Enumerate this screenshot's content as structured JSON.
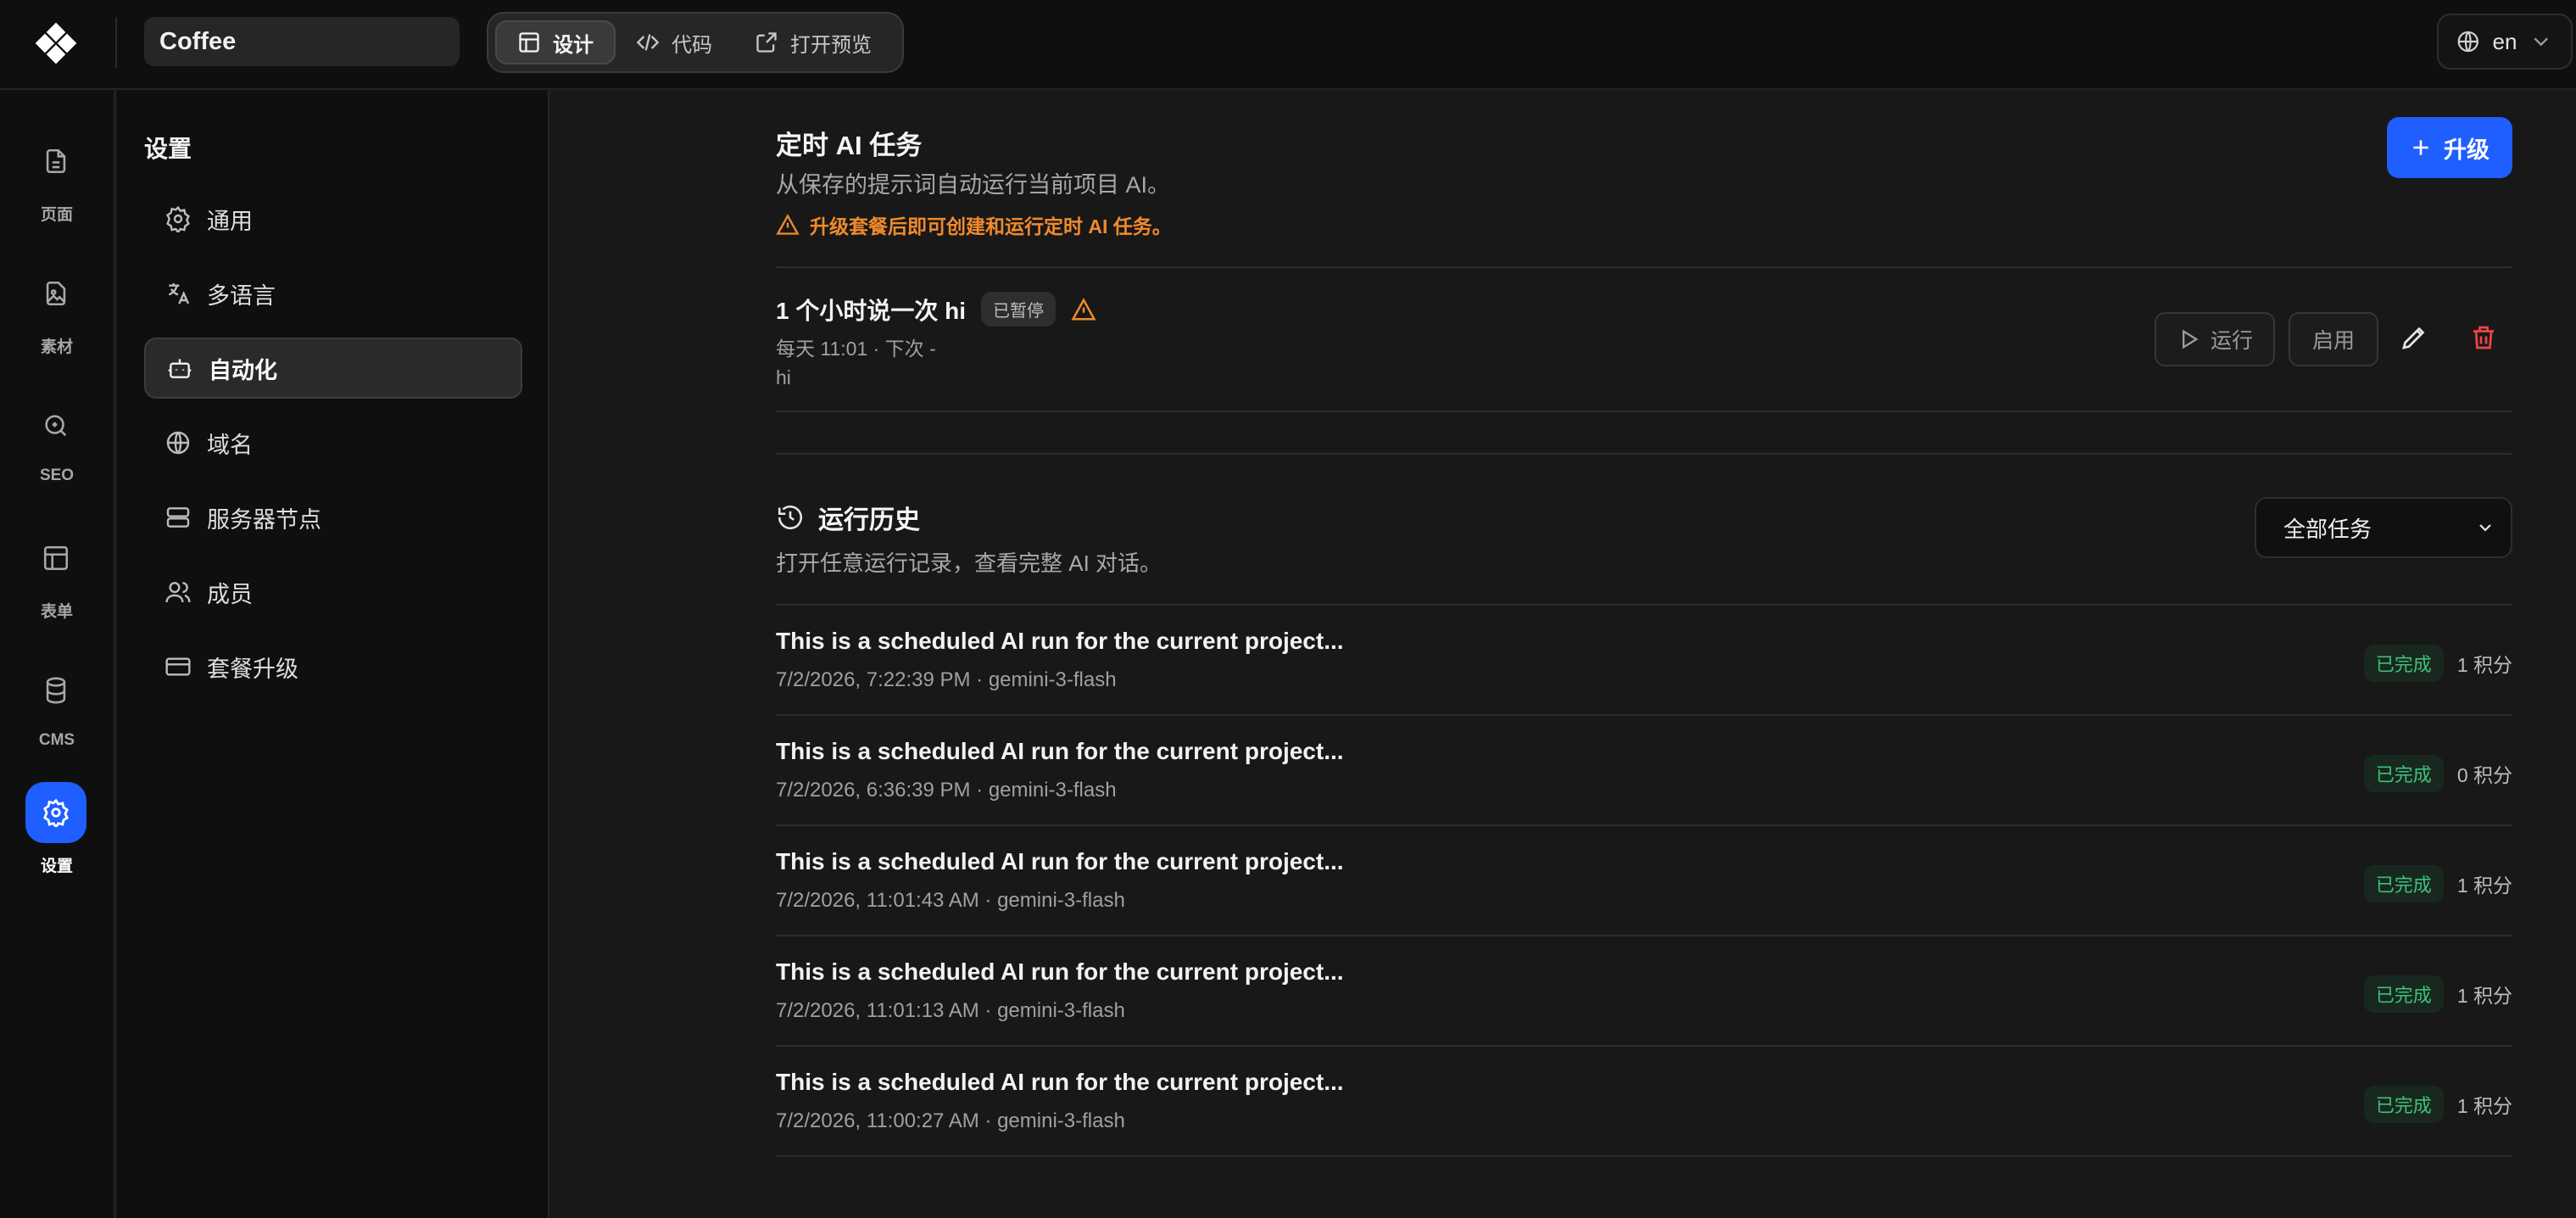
{
  "app": {
    "project_name": "Coffee"
  },
  "mode_tabs": [
    {
      "label": "设计",
      "icon": "layout-icon"
    },
    {
      "label": "代码",
      "icon": "code-icon"
    },
    {
      "label": "打开预览",
      "icon": "external-link-icon"
    }
  ],
  "language": {
    "label": "en",
    "icon": "globe-icon"
  },
  "rail": [
    {
      "label": "页面",
      "icon": "page-icon"
    },
    {
      "label": "素材",
      "icon": "media-icon"
    },
    {
      "label": "SEO",
      "icon": "seo-search-icon"
    },
    {
      "label": "表单",
      "icon": "form-icon"
    },
    {
      "label": "CMS",
      "icon": "database-icon"
    },
    {
      "label": "设置",
      "icon": "gear-icon"
    }
  ],
  "settings": {
    "title": "设置",
    "items": [
      {
        "label": "通用",
        "icon": "gear-icon"
      },
      {
        "label": "多语言",
        "icon": "translate-icon"
      },
      {
        "label": "自动化",
        "icon": "bot-icon"
      },
      {
        "label": "域名",
        "icon": "globe-icon"
      },
      {
        "label": "服务器节点",
        "icon": "server-icon"
      },
      {
        "label": "成员",
        "icon": "users-icon"
      },
      {
        "label": "套餐升级",
        "icon": "card-icon"
      }
    ]
  },
  "scheduled": {
    "title": "定时 AI 任务",
    "description": "从保存的提示词自动运行当前项目 AI。",
    "warning": "升级套餐后即可创建和运行定时 AI 任务。",
    "upgrade_label": "升级",
    "task": {
      "name": "1 个小时说一次 hi",
      "status": "已暂停",
      "schedule": "每天 11:01 · 下次 -",
      "prompt": "hi",
      "run_label": "运行",
      "enable_label": "启用"
    }
  },
  "history": {
    "title": "运行历史",
    "description": "打开任意运行记录，查看完整 AI 对话。",
    "filter_value": "全部任务",
    "runs": [
      {
        "title": "This is a scheduled AI run for the current project...",
        "meta": "7/2/2026, 7:22:39 PM · gemini-3-flash",
        "status": "已完成",
        "credits": "1 积分"
      },
      {
        "title": "This is a scheduled AI run for the current project...",
        "meta": "7/2/2026, 6:36:39 PM · gemini-3-flash",
        "status": "已完成",
        "credits": "0 积分"
      },
      {
        "title": "This is a scheduled AI run for the current project...",
        "meta": "7/2/2026, 11:01:43 AM · gemini-3-flash",
        "status": "已完成",
        "credits": "1 积分"
      },
      {
        "title": "This is a scheduled AI run for the current project...",
        "meta": "7/2/2026, 11:01:13 AM · gemini-3-flash",
        "status": "已完成",
        "credits": "1 积分"
      },
      {
        "title": "This is a scheduled AI run for the current project...",
        "meta": "7/2/2026, 11:00:27 AM · gemini-3-flash",
        "status": "已完成",
        "credits": "1 积分"
      }
    ]
  },
  "colors": {
    "accent": "#1f5eff",
    "warning": "#f08a2c",
    "danger": "#ef4444",
    "success": "#3fc07a",
    "background": "#181818",
    "sidebar": "#0f0f0f"
  }
}
